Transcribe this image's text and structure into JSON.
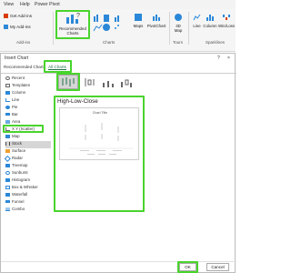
{
  "menu": {
    "items": [
      "View",
      "Help",
      "Power Pivot"
    ]
  },
  "ribbon": {
    "get_addins": "Get Add-ins",
    "my_addins": "My Add-ins",
    "addins_group": "Add-ins",
    "recommended_charts": "Recommended Charts",
    "charts_group": "Charts",
    "maps": "Maps",
    "pivotchart": "PivotChart",
    "map3d": "3D Map",
    "tours_group": "Tours",
    "line": "Line",
    "column": "Column",
    "winloss": "Win/Loss",
    "sparklines_group": "Sparklines"
  },
  "dialog": {
    "title": "Insert Chart",
    "help": "?",
    "close": "×",
    "tab_recommended": "Recommended Charts",
    "tab_all": "All Charts",
    "chart_types": [
      "Recent",
      "Templates",
      "Column",
      "Line",
      "Pie",
      "Bar",
      "Area",
      "X Y (Scatter)",
      "Map",
      "Stock",
      "Surface",
      "Radar",
      "Treemap",
      "Sunburst",
      "Histogram",
      "Box & Whisker",
      "Waterfall",
      "Funnel",
      "Combo"
    ],
    "selected_type": "Stock",
    "subtype_name": "High-Low-Close",
    "preview_title": "Chart Title",
    "ok": "OK",
    "cancel": "Cancel"
  },
  "colors": {
    "highlight": "#49d42d",
    "accent": "#217346"
  }
}
